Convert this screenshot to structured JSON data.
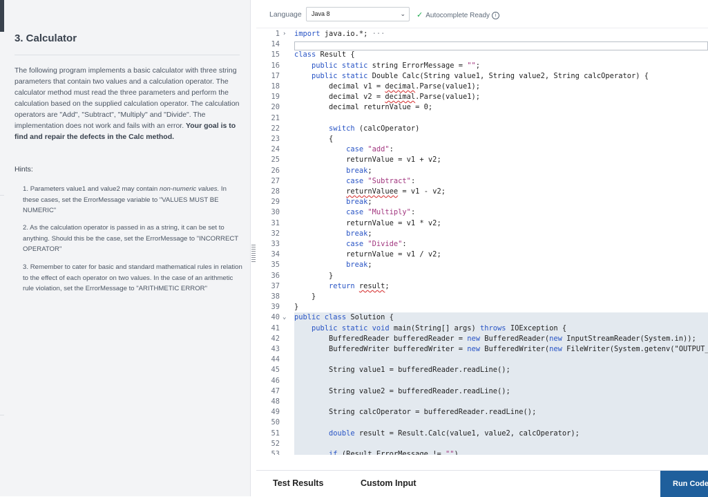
{
  "problem": {
    "title": "3. Calculator",
    "description_parts": [
      "The following program implements a basic calculator with three string parameters that contain two values and a calculation operator. The calculator method must read the three parameters and perform the calculation based on the supplied calculation operator. The calculation operators are \"Add\", \"Subtract\", \"Multiply\" and \"Divide\". The implementation does not work and fails with an error. ",
      "Your goal is to find and repair the defects in the Calc method."
    ],
    "hints_title": "Hints:",
    "hints": [
      {
        "num": "1.",
        "pre": "Parameters value1 and value2 may contain ",
        "em": "non-numeric values.",
        "post": " In these cases, set the ErrorMessage variable to \"VALUES MUST BE NUMERIC\""
      },
      {
        "num": "2.",
        "text": "As the calculation operator is passed in as a string, it can be set to anything. Should this be the case, set the ErrorMessage to \"INCORRECT OPERATOR\""
      },
      {
        "num": "3.",
        "text": "Remember to cater for basic and standard mathematical rules in relation to the effect of each operator on two values. In the case of an arithmetic rule violation, set the ErrorMessage to \"ARITHMETIC ERROR\""
      }
    ]
  },
  "toolbar": {
    "language_label": "Language",
    "language_value": "Java 8",
    "autocomplete_label": "Autocomplete Ready",
    "icons": {
      "language_chevron": "chevron-down-icon",
      "autocomplete_status": "check-circle-icon",
      "autocomplete_info": "info-icon"
    }
  },
  "editor": {
    "lines": [
      {
        "n": "1",
        "fold": "›",
        "html": "<span class=\"kw\">import</span> java.io.*; <span style=\"color:#8a8f97\">···</span>"
      },
      {
        "n": "14",
        "html": ""
      },
      {
        "n": "15",
        "html": "<span class=\"kw\">class</span> Result {"
      },
      {
        "n": "16",
        "html": "    <span class=\"kw\">public static</span> string ErrorMessage = <span class=\"str\">\"\"</span>;"
      },
      {
        "n": "17",
        "html": "    <span class=\"kw\">public static</span> Double Calc(String value1, String value2, String calcOperator) {"
      },
      {
        "n": "18",
        "html": "        decimal v1 = <span class=\"sq\">decimal</span>.Parse(value1);"
      },
      {
        "n": "19",
        "html": "        decimal v2 = <span class=\"sq\">decimal</span>.Parse(value1);"
      },
      {
        "n": "20",
        "html": "        decimal returnValue = 0;"
      },
      {
        "n": "21",
        "html": ""
      },
      {
        "n": "22",
        "html": "        <span class=\"kw\">switch</span> (calcOperator)"
      },
      {
        "n": "23",
        "html": "        {"
      },
      {
        "n": "24",
        "html": "            <span class=\"kw\">case</span> <span class=\"str\">\"add\"</span>:"
      },
      {
        "n": "25",
        "html": "            returnValue = v1 + v2;"
      },
      {
        "n": "26",
        "html": "            <span class=\"kw\">break</span>;"
      },
      {
        "n": "27",
        "html": "            <span class=\"kw\">case</span> <span class=\"str\">\"Subtract\"</span>:"
      },
      {
        "n": "28",
        "html": "            <span class=\"sq\">returnValuee</span> = v1 - v2;"
      },
      {
        "n": "29",
        "html": "            <span class=\"kw\">break</span>;"
      },
      {
        "n": "30",
        "html": "            <span class=\"kw\">case</span> <span class=\"str\">\"Multiply\"</span>:"
      },
      {
        "n": "31",
        "html": "            returnValue = v1 * v2;"
      },
      {
        "n": "32",
        "html": "            <span class=\"kw\">break</span>;"
      },
      {
        "n": "33",
        "html": "            <span class=\"kw\">case</span> <span class=\"str\">\"Divide\"</span>:"
      },
      {
        "n": "34",
        "html": "            returnValue = v1 / v2;"
      },
      {
        "n": "35",
        "html": "            <span class=\"kw\">break</span>;"
      },
      {
        "n": "36",
        "html": "        }"
      },
      {
        "n": "37",
        "html": "        <span class=\"kw\">return</span> <span class=\"sq\">result</span>;"
      },
      {
        "n": "38",
        "html": "    }"
      },
      {
        "n": "39",
        "html": "}"
      },
      {
        "n": "40",
        "fold": "⌄",
        "hl": true,
        "html": "<span class=\"kw\">public class</span> Solution {"
      },
      {
        "n": "41",
        "hl": true,
        "html": "    <span class=\"kw\">public static void</span> main(String[] args) <span class=\"kw\">throws</span> IOException {"
      },
      {
        "n": "42",
        "hl": true,
        "html": "        BufferedReader bufferedReader = <span class=\"kw\">new</span> BufferedReader(<span class=\"kw\">new</span> InputStreamReader(System.in));"
      },
      {
        "n": "43",
        "hl": true,
        "html": "        BufferedWriter bufferedWriter = <span class=\"kw\">new</span> BufferedWriter(<span class=\"kw\">new</span> FileWriter(System.getenv(\"OUTPUT_PATH\")));"
      },
      {
        "n": "44",
        "hl": true,
        "html": ""
      },
      {
        "n": "45",
        "hl": true,
        "html": "        String value1 = bufferedReader.readLine();"
      },
      {
        "n": "46",
        "hl": true,
        "html": ""
      },
      {
        "n": "47",
        "hl": true,
        "html": "        String value2 = bufferedReader.readLine();"
      },
      {
        "n": "48",
        "hl": true,
        "html": ""
      },
      {
        "n": "49",
        "hl": true,
        "html": "        String calcOperator = bufferedReader.readLine();"
      },
      {
        "n": "50",
        "hl": true,
        "html": ""
      },
      {
        "n": "51",
        "hl": true,
        "html": "        <span class=\"kw\">double</span> result = Result.Calc(value1, value2, calcOperator);"
      },
      {
        "n": "52",
        "hl": true,
        "html": ""
      },
      {
        "n": "53",
        "hl": true,
        "html": "        <span class=\"kw\">if</span> (Result.ErrorMessage != <span class=\"str\">\"\"</span>)"
      }
    ]
  },
  "bottom": {
    "test_results_tab": "Test Results",
    "custom_input_tab": "Custom Input",
    "run_button": "Run Code"
  }
}
